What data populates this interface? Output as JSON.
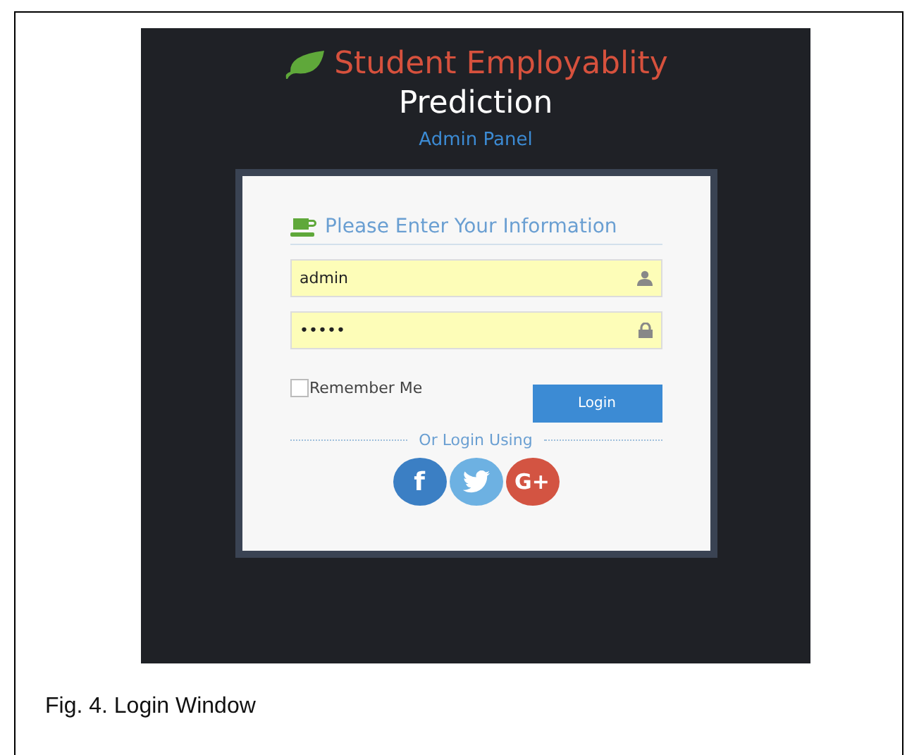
{
  "header": {
    "title": "Student Employablity",
    "subtitle": "Prediction",
    "panel": "Admin Panel"
  },
  "form": {
    "heading": "Please Enter Your Information",
    "fields": [
      {
        "kind": "user",
        "value": "admin"
      },
      {
        "kind": "password",
        "value": "•••••"
      }
    ],
    "remember": {
      "label": "Remember Me",
      "checked": false
    },
    "login_button": "Login",
    "divider": "Or Login Using",
    "social": [
      {
        "kind": "facebook",
        "label": "f"
      },
      {
        "kind": "twitter"
      },
      {
        "kind": "google",
        "label": "G+"
      }
    ]
  },
  "caption": "Fig. 4. Login Window"
}
